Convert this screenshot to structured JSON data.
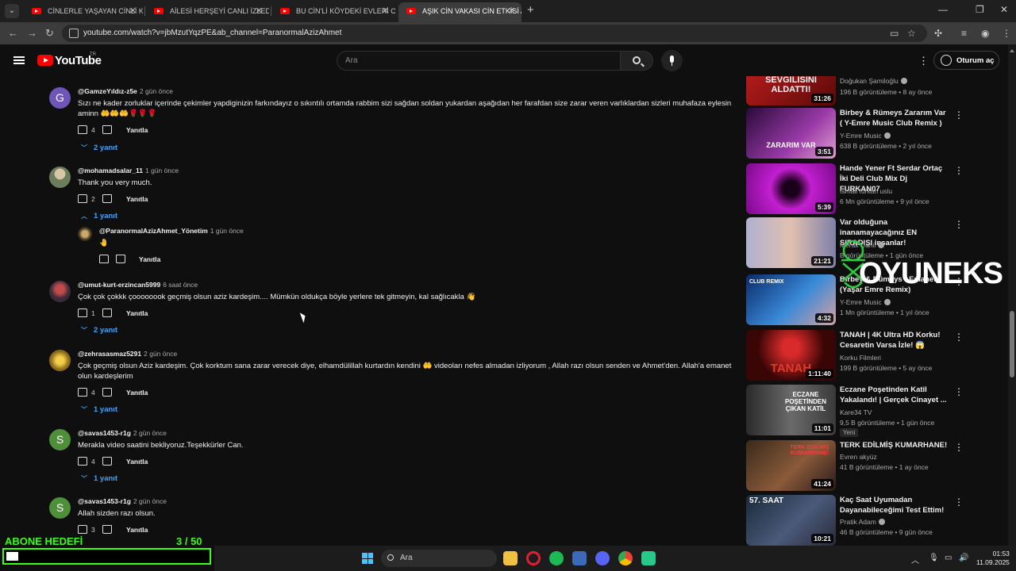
{
  "tabs": [
    {
      "title": "CİNLERLE YAŞAYAN CİNLİ KADIN",
      "active": false
    },
    {
      "title": "AİLESİ HERŞEYİ CANLI İZLEDİ! |",
      "active": false
    },
    {
      "title": "BU CİN'Lİ KÖYDEKİ EVLERİ CİNL",
      "active": false
    },
    {
      "title": "AŞIK CİN VAKASI CİN ETKİSİ ALT",
      "active": true
    }
  ],
  "address": {
    "url": "youtube.com/watch?v=jbMzutYqzPE&ab_channel=ParanormalAzizAhmet"
  },
  "header": {
    "logo_text": "YouTube",
    "logo_region": "TR",
    "search_placeholder": "Ara",
    "signin_label": "Oturum aç"
  },
  "comments": [
    {
      "author": "@GamzeYıldız-z5e",
      "time": "2 gün önce",
      "avatar_letter": "G",
      "avatar_color": "#6f55b8",
      "text": "Sızı ne kader zorluklar içerinde çekimler yapdiginizin farkındayız o sıkıntılı ortamda rabbim sizi sağdan soldan yukardan aşağıdan her farafdan size zarar veren varlıklardan sizleri muhafaza eylesin aminn 🤲🤲🤲🌹🌹🌹",
      "likes": "4",
      "reply_label": "Yanıtla",
      "replies": "2 yanıt"
    },
    {
      "author": "@mohamadsalar_11",
      "time": "1 gün önce",
      "avatar_letter": "",
      "avatar_color": "#6b7d5a",
      "text": "Thank you very much.",
      "likes": "2",
      "reply_label": "Yanıtla",
      "replies": "1 yanıt"
    },
    {
      "author": "@ParanormalAzizAhmet_Yönetim",
      "time": "1 gün önce",
      "avatar_letter": "",
      "avatar_color": "#7a6a4a",
      "text": "🤚",
      "likes": "",
      "reply_label": "Yanıtla",
      "replies": ""
    },
    {
      "author": "@umut-kurt-erzincan5999",
      "time": "6 saat önce",
      "avatar_letter": "",
      "avatar_color": "#6a4a5a",
      "text": "Çok çok çokkk çoooooook geçmiş olsun aziz kardeşim.... Mümkün oldukça böyle yerlere tek gitmeyin, kal sağlıcakla 👋",
      "likes": "1",
      "reply_label": "Yanıtla",
      "replies": "2 yanıt"
    },
    {
      "author": "@zehrasasmaz5291",
      "time": "2 gün önce",
      "avatar_letter": "",
      "avatar_color": "#b99a2a",
      "text": "Çok geçmiş olsun Aziz kardeşim. Çok korktum sana zarar verecek diye, elhamdülillah kurtardın kendini 🤲 videoları nefes almadan izliyorum , Allah razı olsun senden ve Ahmet'den. Allah'a emanet olun kardeşlerim",
      "likes": "4",
      "reply_label": "Yanıtla",
      "replies": "1 yanıt"
    },
    {
      "author": "@savas1453-r1g",
      "time": "2 gün önce",
      "avatar_letter": "S",
      "avatar_color": "#4f8f3a",
      "text": "Merakla video saatini bekliyoruz.Teşekkürler Can.",
      "likes": "4",
      "reply_label": "Yanıtla",
      "replies": "1 yanıt"
    },
    {
      "author": "@savas1453-r1g",
      "time": "2 gün önce",
      "avatar_letter": "S",
      "avatar_color": "#4f8f3a",
      "text": "Allah sizden razı olsun.",
      "likes": "3",
      "reply_label": "Yanıtla",
      "replies": ""
    }
  ],
  "videos": [
    {
      "title": "",
      "thumb_caption": "SEVGİLİSİNİ ALDATTI!",
      "channel": "Doğukan Şamiloğlu",
      "verified": true,
      "meta": "196 B görüntüleme • 8 ay önce",
      "duration": "31:26",
      "badge": "",
      "thumb_color": "#9e1b1b"
    },
    {
      "title": "Birbey & Rümeys Zararım Var ( Y-Emre Music Club Remix )",
      "thumb_caption": "ZARARIM VAR",
      "channel": "Y-Emre Music",
      "verified": true,
      "meta": "638 B görüntüleme • 2 yıl önce",
      "duration": "3:51",
      "badge": "",
      "thumb_color": "#6a2a7a"
    },
    {
      "title": "Hande Yener Ft  Serdar Ortaç İki Deli Club Mix Dj FURKAN07",
      "thumb_caption": "",
      "channel": "İsmail furkan uslu",
      "verified": false,
      "meta": "6 Mn görüntüleme • 9 yıl önce",
      "duration": "5:39",
      "badge": "",
      "thumb_color": "#c21fd0"
    },
    {
      "title": "Var olduğuna inanamayacağınız EN SIRADIŞI insanlar!",
      "thumb_caption": "",
      "channel": "Merak Dahil",
      "verified": true,
      "meta": "B görüntüleme • 1 gün önce",
      "duration": "21:21",
      "badge": "",
      "thumb_color": "#8a8ab0"
    },
    {
      "title": "Birbey & Rümeys - Emanet (Yaşar Emre Remix)",
      "thumb_caption": "CLUB REMIX",
      "channel": "Y-Emre Music",
      "verified": true,
      "meta": "1 Mn görüntüleme • 1 yıl önce",
      "duration": "4:32",
      "badge": "",
      "thumb_color": "#1d5fa8"
    },
    {
      "title": "TANAH | 4K Ultra HD Korku! Cesaretin Varsa İzle! 😱",
      "thumb_caption": "TANAH",
      "channel": "Korku Filmleri",
      "verified": false,
      "meta": "199 B görüntüleme • 5 ay önce",
      "duration": "1:11:40",
      "badge": "",
      "thumb_color": "#5a0d0d"
    },
    {
      "title": "Eczane Poşetinden Katil Yakalandı! | Gerçek Cinayet ...",
      "thumb_caption": "ECZANE POŞETİNDEN ÇIKAN KATİL",
      "channel": "Kare34 TV",
      "verified": false,
      "meta": "9,5 B görüntüleme • 1 gün önce",
      "duration": "11:01",
      "badge": "Yeni",
      "thumb_color": "#3a3a3a"
    },
    {
      "title": "TERK EDİLMİŞ KUMARHANE!",
      "thumb_caption": "TERK EDİLMİŞ KUMARHANE!",
      "channel": "Evren akyüz",
      "verified": false,
      "meta": "41 B görüntüleme • 1 ay önce",
      "duration": "41:24",
      "badge": "",
      "thumb_color": "#5a3a2a"
    },
    {
      "title": "Kaç Saat Uyumadan Dayanabileceğimi Test Ettim!",
      "thumb_caption": "57. SAAT",
      "channel": "Pratik Adam",
      "verified": true,
      "meta": "46 B görüntüleme • 9 gün önce",
      "duration": "10:21",
      "badge": "",
      "thumb_color": "#2a3a4a"
    }
  ],
  "overlay": {
    "watermark": "OYUNEKS",
    "goal_label": "ABONE HEDEFİ",
    "goal_current": "3",
    "goal_total": "/ 50",
    "goal_count_text": "3   / 50",
    "goal_progress": 0.06
  },
  "taskbar": {
    "search_label": "Ara",
    "time": "01:53",
    "date": "11.09.2025"
  },
  "colors": {
    "accent_link": "#3ea6ff",
    "brand_red": "#ff0000",
    "goal_green": "#39ff14"
  }
}
